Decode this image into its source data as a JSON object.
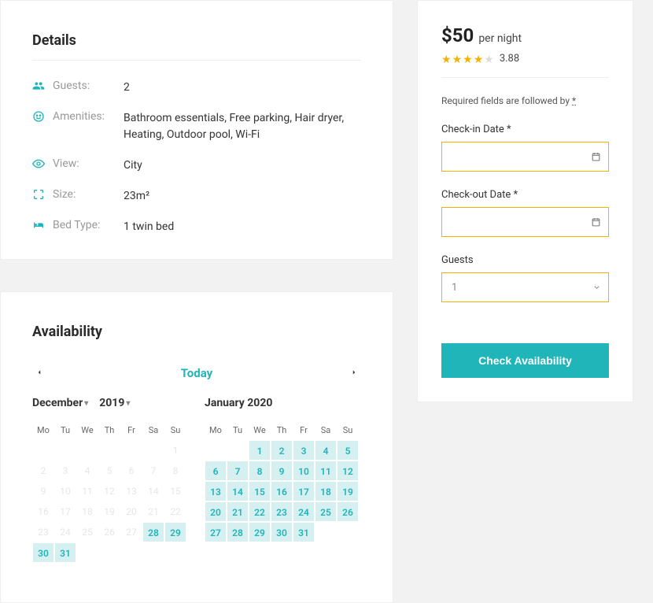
{
  "details": {
    "title": "Details",
    "rows": [
      {
        "label": "Guests:",
        "value": "2"
      },
      {
        "label": "Amenities:",
        "value": "Bathroom essentials, Free parking, Hair dryer, Heating, Outdoor pool, Wi-Fi"
      },
      {
        "label": "View:",
        "value": "City"
      },
      {
        "label": "Size:",
        "value": "23m²"
      },
      {
        "label": "Bed Type:",
        "value": "1 twin bed"
      }
    ]
  },
  "availability": {
    "title": "Availability",
    "today_label": "Today",
    "month1": {
      "name": "December",
      "year": "2019"
    },
    "month2": {
      "name": "January 2020"
    },
    "dow": [
      "Mo",
      "Tu",
      "We",
      "Th",
      "Fr",
      "Sa",
      "Su"
    ],
    "dec_disabled": [
      "",
      "",
      "",
      "",
      "",
      "",
      "1",
      "2",
      "3",
      "4",
      "5",
      "6",
      "7",
      "8",
      "9",
      "10",
      "11",
      "12",
      "13",
      "14",
      "15",
      "16",
      "17",
      "18",
      "19",
      "20",
      "21",
      "22",
      "23",
      "24",
      "25",
      "26",
      "27"
    ],
    "dec_avail": [
      "28",
      "29",
      "30",
      "31"
    ],
    "jan_avail": [
      "1",
      "2",
      "3",
      "4",
      "5",
      "6",
      "7",
      "8",
      "9",
      "10",
      "11",
      "12",
      "13",
      "14",
      "15",
      "16",
      "17",
      "18",
      "19",
      "20",
      "21",
      "22",
      "23",
      "24",
      "25",
      "26",
      "27",
      "28",
      "29",
      "30",
      "31"
    ]
  },
  "sidebar": {
    "price": "$50",
    "per_night": "per night",
    "rating": "3.88",
    "required_note": "Required fields are followed by ",
    "asterisk": "*",
    "checkin_label": "Check-in Date *",
    "checkout_label": "Check-out Date *",
    "guests_label": "Guests",
    "guests_value": "1",
    "check_btn": "Check Availability"
  }
}
